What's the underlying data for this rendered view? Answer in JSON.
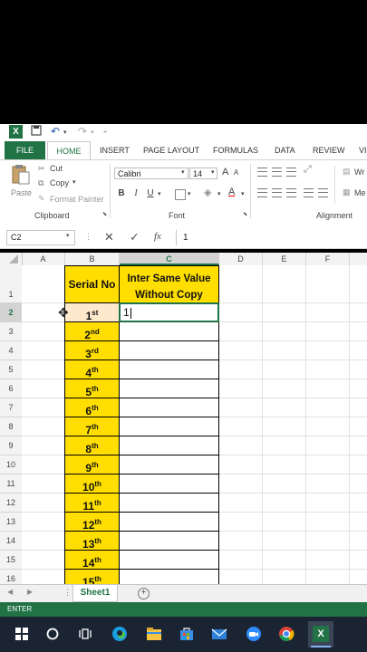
{
  "window": {
    "app_icon": "X"
  },
  "ribbon_tabs": [
    "FILE",
    "HOME",
    "INSERT",
    "PAGE LAYOUT",
    "FORMULAS",
    "DATA",
    "REVIEW",
    "VI"
  ],
  "clipboard": {
    "paste": "Paste",
    "cut": "Cut",
    "copy": "Copy",
    "format_painter": "Format Painter",
    "group": "Clipboard"
  },
  "font": {
    "name": "Calibri",
    "size": "14",
    "bold": "B",
    "italic": "I",
    "underline": "U",
    "color_letter": "A",
    "group": "Font"
  },
  "alignment": {
    "group": "Alignment",
    "wrap": "Wr",
    "merge": "Me"
  },
  "formula_bar": {
    "name_box": "C2",
    "fx": "fx",
    "value": "1"
  },
  "columns": [
    "A",
    "B",
    "C",
    "D",
    "E",
    "F"
  ],
  "rows": [
    "1",
    "2",
    "3",
    "4",
    "5",
    "6",
    "7",
    "8",
    "9",
    "10",
    "11",
    "12",
    "13",
    "14",
    "15",
    "16"
  ],
  "table": {
    "header_serial": "Serial No",
    "header_value_line1": "Inter Same Value",
    "header_value_line2": "Without Copy",
    "serials": [
      {
        "n": "1",
        "s": "st"
      },
      {
        "n": "2",
        "s": "nd"
      },
      {
        "n": "3",
        "s": "rd"
      },
      {
        "n": "4",
        "s": "th"
      },
      {
        "n": "5",
        "s": "th"
      },
      {
        "n": "6",
        "s": "th"
      },
      {
        "n": "7",
        "s": "th"
      },
      {
        "n": "8",
        "s": "th"
      },
      {
        "n": "9",
        "s": "th"
      },
      {
        "n": "10",
        "s": "th"
      },
      {
        "n": "11",
        "s": "th"
      },
      {
        "n": "12",
        "s": "th"
      },
      {
        "n": "13",
        "s": "th"
      },
      {
        "n": "14",
        "s": "th"
      },
      {
        "n": "15",
        "s": "th"
      }
    ],
    "c2_value": "1"
  },
  "sheet_tab": "Sheet1",
  "status": "ENTER",
  "colors": {
    "excel_green": "#217346",
    "serial_fill": "#ffde00",
    "taskbar": "#1b2433"
  }
}
